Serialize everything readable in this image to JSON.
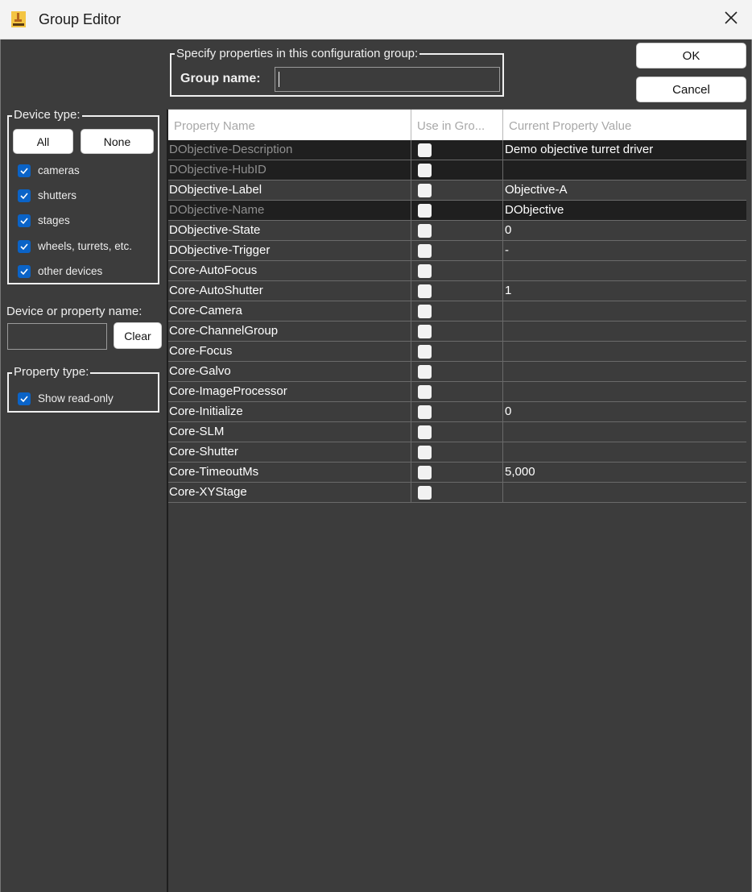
{
  "window": {
    "title": "Group Editor"
  },
  "group": {
    "legend": "Specify properties in this configuration group:",
    "name_label": "Group name:",
    "name_value": ""
  },
  "actions": {
    "ok": "OK",
    "cancel": "Cancel"
  },
  "device_type": {
    "legend": "Device type:",
    "all": "All",
    "none": "None",
    "items": [
      {
        "label": "cameras",
        "checked": true
      },
      {
        "label": "shutters",
        "checked": true
      },
      {
        "label": "stages",
        "checked": true
      },
      {
        "label": "wheels, turrets, etc.",
        "checked": true
      },
      {
        "label": "other devices",
        "checked": true
      }
    ]
  },
  "filter": {
    "label": "Device or property name:",
    "value": "",
    "clear": "Clear"
  },
  "property_type": {
    "legend": "Property type:",
    "show_readonly": {
      "label": "Show read-only",
      "checked": true
    }
  },
  "table": {
    "columns": [
      "Property Name",
      "Use in Gro...",
      "Current Property Value"
    ],
    "rows": [
      {
        "name": "DObjective-Description",
        "value": "Demo objective turret driver",
        "readonly": true,
        "use": false
      },
      {
        "name": "DObjective-HubID",
        "value": "",
        "readonly": true,
        "use": false
      },
      {
        "name": "DObjective-Label",
        "value": "Objective-A",
        "readonly": false,
        "use": false
      },
      {
        "name": "DObjective-Name",
        "value": "DObjective",
        "readonly": true,
        "use": false
      },
      {
        "name": "DObjective-State",
        "value": "0",
        "readonly": false,
        "use": false
      },
      {
        "name": "DObjective-Trigger",
        "value": "-",
        "readonly": false,
        "use": false
      },
      {
        "name": "Core-AutoFocus",
        "value": "",
        "readonly": false,
        "use": false
      },
      {
        "name": "Core-AutoShutter",
        "value": "1",
        "readonly": false,
        "use": false
      },
      {
        "name": "Core-Camera",
        "value": "",
        "readonly": false,
        "use": false
      },
      {
        "name": "Core-ChannelGroup",
        "value": "",
        "readonly": false,
        "use": false
      },
      {
        "name": "Core-Focus",
        "value": "",
        "readonly": false,
        "use": false
      },
      {
        "name": "Core-Galvo",
        "value": "",
        "readonly": false,
        "use": false
      },
      {
        "name": "Core-ImageProcessor",
        "value": "",
        "readonly": false,
        "use": false
      },
      {
        "name": "Core-Initialize",
        "value": "0",
        "readonly": false,
        "use": false
      },
      {
        "name": "Core-SLM",
        "value": "",
        "readonly": false,
        "use": false
      },
      {
        "name": "Core-Shutter",
        "value": "",
        "readonly": false,
        "use": false
      },
      {
        "name": "Core-TimeoutMs",
        "value": "5,000",
        "readonly": false,
        "use": false
      },
      {
        "name": "Core-XYStage",
        "value": "",
        "readonly": false,
        "use": false
      }
    ]
  },
  "colors": {
    "background": "#3c3c3c",
    "readonly_row": "#1f1f1f",
    "checkbox_accent": "#0a63c7"
  }
}
